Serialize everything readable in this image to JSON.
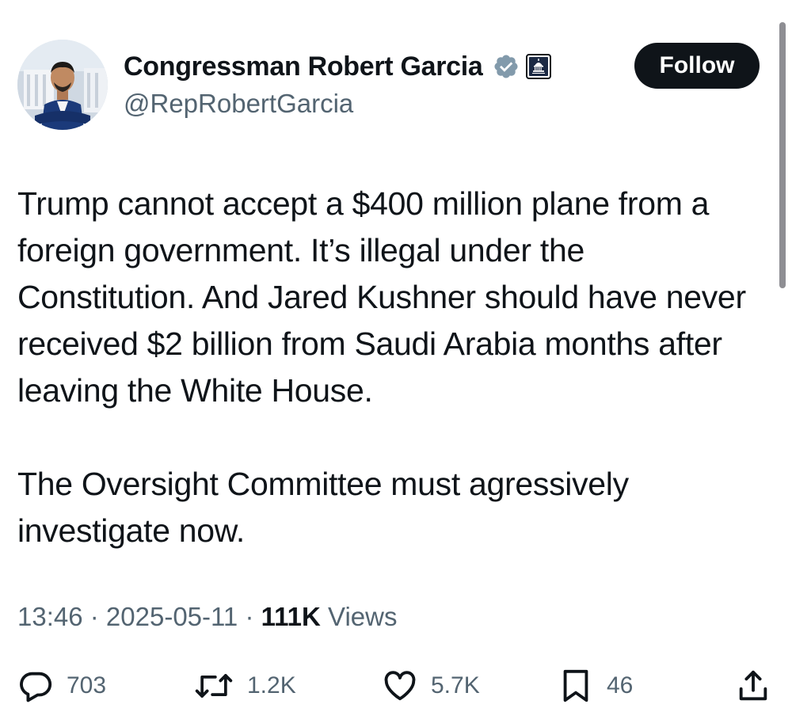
{
  "author": {
    "display_name": "Congressman Robert Garcia",
    "handle": "@RepRobertGarcia",
    "verified_icon": "verified-badge-icon",
    "affiliation_icon": "capitol-dome-icon"
  },
  "follow_label": "Follow",
  "tweet": {
    "paragraph_1": "Trump cannot accept a $400 million plane from a foreign government. It’s illegal under the Constitution. And Jared Kushner should have never received $2 billion from Saudi Arabia months after leaving the White House.",
    "paragraph_2": "The Oversight Committee must agressively investigate now."
  },
  "meta": {
    "time": "13:46",
    "separator": " · ",
    "date": "2025-05-11",
    "views_count": "111K",
    "views_label": " Views"
  },
  "actions": {
    "replies": "703",
    "reposts": "1.2K",
    "likes": "5.7K",
    "bookmarks": "46"
  },
  "colors": {
    "text": "#0f1419",
    "secondary": "#536471",
    "verified": "#829aab",
    "follow_bg": "#0f1419"
  }
}
